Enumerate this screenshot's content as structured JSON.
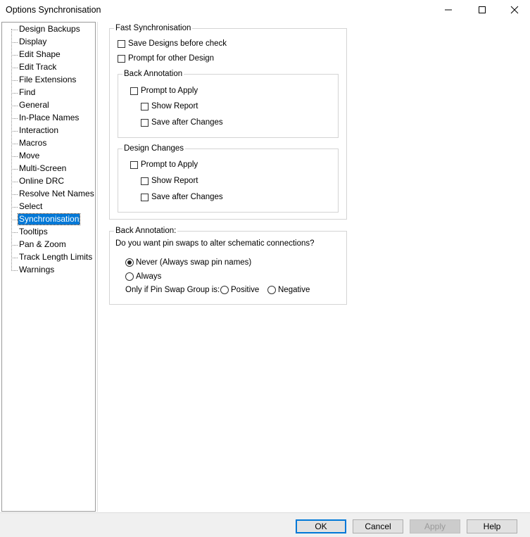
{
  "window": {
    "title": "Options  Synchronisation",
    "controls": [
      "minimize-icon",
      "maximize-icon",
      "close-icon"
    ]
  },
  "tree": {
    "items": [
      {
        "label": "Design Backups",
        "selected": false
      },
      {
        "label": "Display",
        "selected": false
      },
      {
        "label": "Edit Shape",
        "selected": false
      },
      {
        "label": "Edit Track",
        "selected": false
      },
      {
        "label": "File Extensions",
        "selected": false
      },
      {
        "label": "Find",
        "selected": false
      },
      {
        "label": "General",
        "selected": false
      },
      {
        "label": "In-Place Names",
        "selected": false
      },
      {
        "label": "Interaction",
        "selected": false
      },
      {
        "label": "Macros",
        "selected": false
      },
      {
        "label": "Move",
        "selected": false
      },
      {
        "label": "Multi-Screen",
        "selected": false
      },
      {
        "label": "Online DRC",
        "selected": false
      },
      {
        "label": "Resolve Net Names",
        "selected": false
      },
      {
        "label": "Select",
        "selected": false
      },
      {
        "label": "Synchronisation",
        "selected": true
      },
      {
        "label": "Tooltips",
        "selected": false
      },
      {
        "label": "Pan & Zoom",
        "selected": false
      },
      {
        "label": "Track Length Limits",
        "selected": false
      },
      {
        "label": "Warnings",
        "selected": false
      }
    ]
  },
  "fast_sync": {
    "title": "Fast Synchronisation",
    "save_designs": {
      "label": "Save Designs before check",
      "checked": false
    },
    "prompt_other": {
      "label": "Prompt for other Design",
      "checked": false
    },
    "back_annotation": {
      "title": "Back Annotation",
      "prompt_apply": {
        "label": "Prompt to Apply",
        "checked": false
      },
      "show_report": {
        "label": "Show Report",
        "checked": false
      },
      "save_after": {
        "label": "Save after Changes",
        "checked": false
      }
    },
    "design_changes": {
      "title": "Design Changes",
      "prompt_apply": {
        "label": "Prompt to Apply",
        "checked": false
      },
      "show_report": {
        "label": "Show Report",
        "checked": false
      },
      "save_after": {
        "label": "Save after Changes",
        "checked": false
      }
    }
  },
  "back_annotation": {
    "title": "Back Annotation:",
    "question": "Do you want pin swaps to alter schematic connections?",
    "never": {
      "label": "Never (Always swap pin names)",
      "selected": true
    },
    "always": {
      "label": "Always",
      "selected": false
    },
    "only_if_label": "Only if Pin Swap Group is:",
    "positive": {
      "label": "Positive",
      "selected": false
    },
    "negative": {
      "label": "Negative",
      "selected": false
    }
  },
  "buttons": {
    "ok": "OK",
    "cancel": "Cancel",
    "apply": "Apply",
    "help": "Help"
  },
  "colors": {
    "selection": "#0078d7",
    "dialog_bg": "#f0f0f0"
  }
}
